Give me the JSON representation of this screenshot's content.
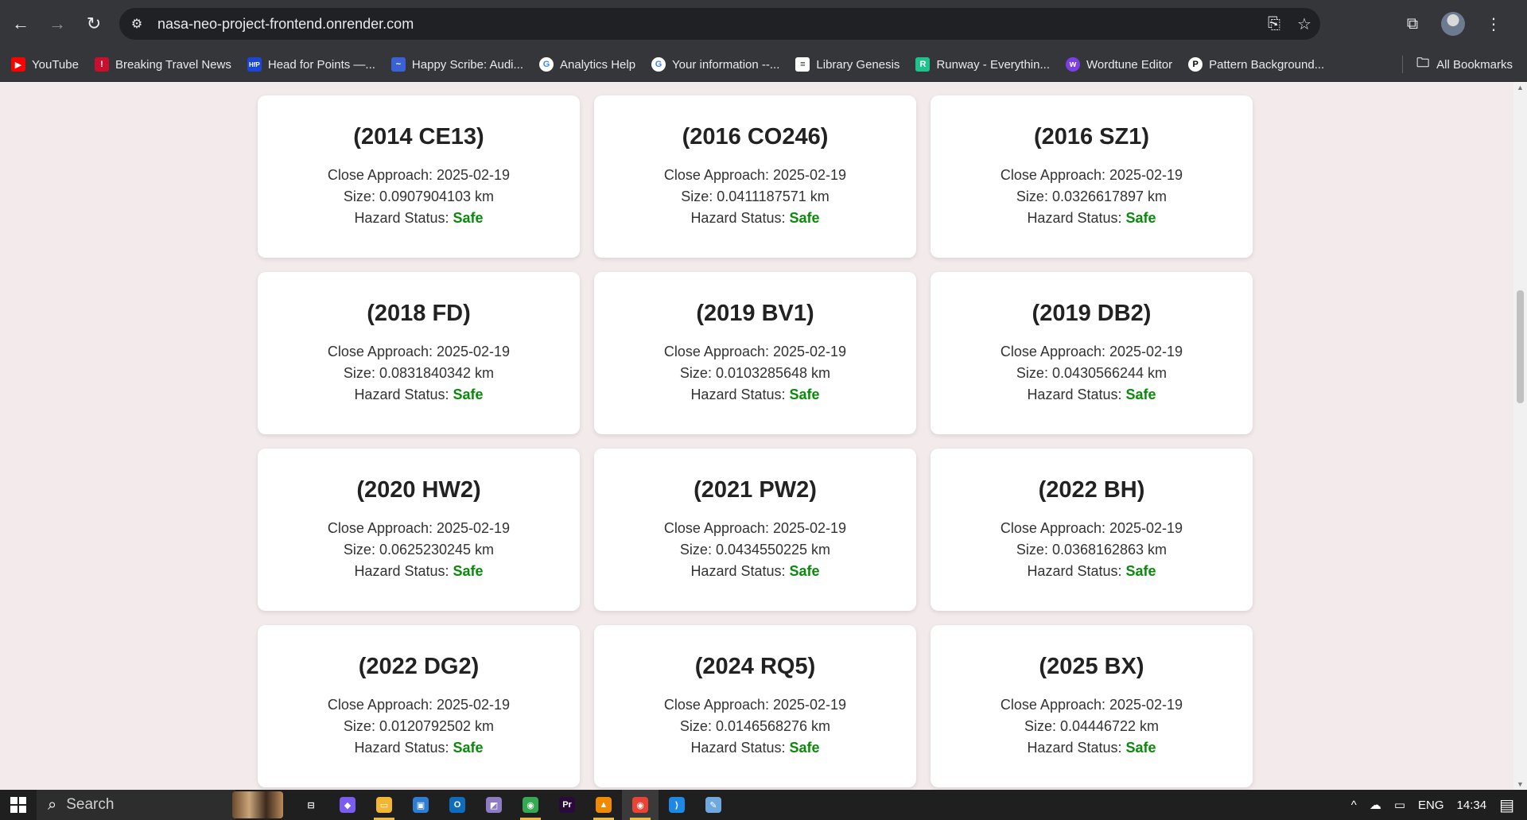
{
  "browser": {
    "url": "nasa-neo-project-frontend.onrender.com",
    "back_icon": "←",
    "forward_icon": "→",
    "reload_icon": "↻",
    "site_info_icon": "⚙",
    "install_icon": "⎘",
    "star_icon": "☆",
    "extensions_icon": "⧉",
    "menu_icon": "⋮"
  },
  "bookmarks": {
    "items": [
      {
        "label": "YouTube",
        "icon": "▶",
        "color": "#ff0000"
      },
      {
        "label": "Breaking Travel News",
        "icon": "!",
        "color": "#c8102e"
      },
      {
        "label": "Head for Points —...",
        "icon": "HfP",
        "color": "#1a47d6"
      },
      {
        "label": "Happy Scribe: Audi...",
        "icon": "~",
        "color": "#3a62d6"
      },
      {
        "label": "Analytics Help",
        "icon": "G",
        "color": "#ffffff"
      },
      {
        "label": "Your information --...",
        "icon": "G",
        "color": "#ffffff"
      },
      {
        "label": "Library Genesis",
        "icon": "≡",
        "color": "#ffffff"
      },
      {
        "label": "Runway - Everythin...",
        "icon": "R",
        "color": "#1ec28b"
      },
      {
        "label": "Wordtune Editor",
        "icon": "w",
        "color": "#7b3fe4"
      },
      {
        "label": "Pattern Background...",
        "icon": "P",
        "color": "#ffffff"
      }
    ],
    "all_label": "All Bookmarks",
    "folder_icon": "🗀"
  },
  "cards": [
    {
      "name": "(2014 CE13)",
      "approach_label": "Close Approach: 2025-02-19",
      "size_label": "Size: 0.0907904103 km",
      "hazard_label": "Hazard Status:",
      "hazard_value": "Safe"
    },
    {
      "name": "(2016 CO246)",
      "approach_label": "Close Approach: 2025-02-19",
      "size_label": "Size: 0.0411187571 km",
      "hazard_label": "Hazard Status:",
      "hazard_value": "Safe"
    },
    {
      "name": "(2016 SZ1)",
      "approach_label": "Close Approach: 2025-02-19",
      "size_label": "Size: 0.0326617897 km",
      "hazard_label": "Hazard Status:",
      "hazard_value": "Safe"
    },
    {
      "name": "(2018 FD)",
      "approach_label": "Close Approach: 2025-02-19",
      "size_label": "Size: 0.0831840342 km",
      "hazard_label": "Hazard Status:",
      "hazard_value": "Safe"
    },
    {
      "name": "(2019 BV1)",
      "approach_label": "Close Approach: 2025-02-19",
      "size_label": "Size: 0.0103285648 km",
      "hazard_label": "Hazard Status:",
      "hazard_value": "Safe"
    },
    {
      "name": "(2019 DB2)",
      "approach_label": "Close Approach: 2025-02-19",
      "size_label": "Size: 0.0430566244 km",
      "hazard_label": "Hazard Status:",
      "hazard_value": "Safe"
    },
    {
      "name": "(2020 HW2)",
      "approach_label": "Close Approach: 2025-02-19",
      "size_label": "Size: 0.0625230245 km",
      "hazard_label": "Hazard Status:",
      "hazard_value": "Safe"
    },
    {
      "name": "(2021 PW2)",
      "approach_label": "Close Approach: 2025-02-19",
      "size_label": "Size: 0.0434550225 km",
      "hazard_label": "Hazard Status:",
      "hazard_value": "Safe"
    },
    {
      "name": "(2022 BH)",
      "approach_label": "Close Approach: 2025-02-19",
      "size_label": "Size: 0.0368162863 km",
      "hazard_label": "Hazard Status:",
      "hazard_value": "Safe"
    },
    {
      "name": "(2022 DG2)",
      "approach_label": "Close Approach: 2025-02-19",
      "size_label": "Size: 0.0120792502 km",
      "hazard_label": "Hazard Status:",
      "hazard_value": "Safe"
    },
    {
      "name": "(2024 RQ5)",
      "approach_label": "Close Approach: 2025-02-19",
      "size_label": "Size: 0.0146568276 km",
      "hazard_label": "Hazard Status:",
      "hazard_value": "Safe"
    },
    {
      "name": "(2025 BX)",
      "approach_label": "Close Approach: 2025-02-19",
      "size_label": "Size: 0.04446722 km",
      "hazard_label": "Hazard Status:",
      "hazard_value": "Safe"
    }
  ],
  "colors": {
    "page_bg": "#f3ebeb",
    "safe": "#0a8a0a",
    "chrome": "#35363a"
  },
  "taskbar": {
    "search_label": "Search",
    "apps": [
      {
        "icon": "task-view-icon",
        "glyph": "⊟",
        "color": "#1f1f1f"
      },
      {
        "icon": "copilot-icon",
        "glyph": "◆",
        "color": "#7a5cf0"
      },
      {
        "icon": "file-explorer-icon",
        "glyph": "▭",
        "color": "#f2b632"
      },
      {
        "icon": "app-icon",
        "glyph": "▣",
        "color": "#2d7dd2"
      },
      {
        "icon": "outlook-icon",
        "glyph": "O",
        "color": "#0f6cbd"
      },
      {
        "icon": "photos-icon",
        "glyph": "◩",
        "color": "#8e7cc3"
      },
      {
        "icon": "chrome-icon",
        "glyph": "◉",
        "color": "#34a853"
      },
      {
        "icon": "premiere-icon",
        "glyph": "Pr",
        "color": "#2a0a3a"
      },
      {
        "icon": "vlc-icon",
        "glyph": "▲",
        "color": "#f08a00"
      },
      {
        "icon": "chrome-active-icon",
        "glyph": "◉",
        "color": "#ea4335"
      },
      {
        "icon": "vscode-icon",
        "glyph": "⟩",
        "color": "#1e88e5"
      },
      {
        "icon": "notepad-icon",
        "glyph": "✎",
        "color": "#6fa8dc"
      }
    ],
    "language": "ENG",
    "time": "14:34",
    "tray_chevron": "^",
    "onedrive_icon": "☁",
    "battery_icon": "▭",
    "notification_icon": "▤"
  }
}
